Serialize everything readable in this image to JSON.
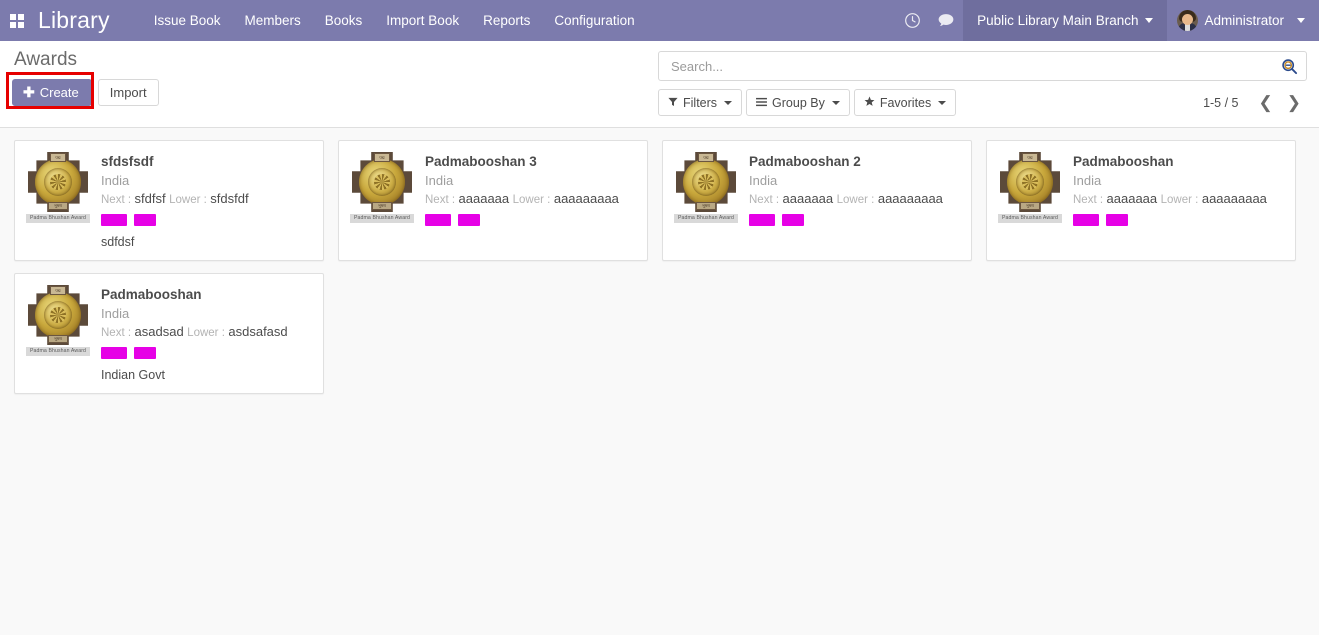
{
  "navbar": {
    "apps_icon": "apps-grid-icon",
    "brand": "Library",
    "menu_items": [
      {
        "label": "Issue Book"
      },
      {
        "label": "Members"
      },
      {
        "label": "Books"
      },
      {
        "label": "Import Book"
      },
      {
        "label": "Reports"
      },
      {
        "label": "Configuration"
      }
    ],
    "activity_icon": "clock-icon",
    "messaging_icon": "chat-bubble-icon",
    "branch": "Public Library Main Branch",
    "user": "Administrator",
    "avatar_icon": "user-avatar",
    "bg_color": "#7c7bad",
    "branch_bg_color": "#6f6e9e"
  },
  "control_panel": {
    "title": "Awards",
    "create_label": "Create",
    "create_plus": "✚",
    "import_label": "Import",
    "highlight_color": "#e60000",
    "highlight_target": "create-button"
  },
  "search": {
    "placeholder": "Search...",
    "value": "",
    "search_icon": "magnifier-minus-icon"
  },
  "filters": [
    {
      "name": "filters",
      "label": "Filters",
      "icon": "funnel-icon",
      "glyph": "▼"
    },
    {
      "name": "group-by",
      "label": "Group By",
      "icon": "list-lines-icon",
      "glyph": "☰"
    },
    {
      "name": "favorites",
      "label": "Favorites",
      "icon": "star-icon",
      "glyph": "★"
    }
  ],
  "pager": {
    "count": "1-5 / 5",
    "prev_icon": "chevron-left-icon",
    "prev_glyph": "❮",
    "next_icon": "chevron-right-icon",
    "next_glyph": "❯"
  },
  "kanban": {
    "medal_caption": "Padma Bhushan Award",
    "medal_top_text": "पद्म",
    "medal_bottom_text": "भूषण",
    "next_label": "Next :",
    "lower_label": "Lower :",
    "tag_color": "#e601e6",
    "cards": [
      {
        "title": "sfdsfsdf",
        "country": "India",
        "next": "sfdfsf",
        "lower": "sfdsfdf",
        "tags": 2,
        "footer": "sdfdsf"
      },
      {
        "title": "Padmabooshan 3",
        "country": "India",
        "next": "aaaaaaa",
        "lower": "aaaaaaaaa",
        "tags": 2,
        "footer": ""
      },
      {
        "title": "Padmabooshan 2",
        "country": "India",
        "next": "aaaaaaa",
        "lower": "aaaaaaaaa",
        "tags": 2,
        "footer": ""
      },
      {
        "title": "Padmabooshan",
        "country": "India",
        "next": "aaaaaaa",
        "lower": "aaaaaaaaa",
        "tags": 2,
        "footer": ""
      },
      {
        "title": "Padmabooshan",
        "country": "India",
        "next": "asadsad",
        "lower": "asdsafasd",
        "tags": 2,
        "footer": "Indian Govt"
      }
    ]
  }
}
